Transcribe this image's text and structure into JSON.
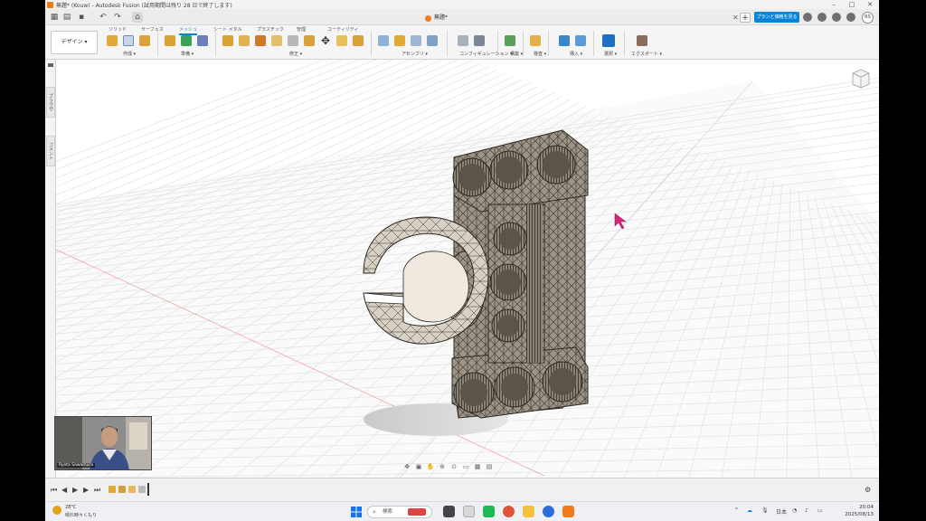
{
  "window": {
    "title": "無題* (Kouw) - Autodesk Fusion (試用期間は残り 28 日で終了します)",
    "min": "–",
    "max": "□",
    "close": "✕"
  },
  "qat": {
    "doc_tab": "無題*",
    "tab_close": "✕",
    "new_tab": "+",
    "upgrade_label": "プランと価格を見る",
    "user_initials": "RS"
  },
  "ribbon": {
    "workspace": "デザイン ▾",
    "tabs": [
      "ソリッド",
      "サーフェス",
      "メッシュ",
      "シート メタル",
      "プラスチック",
      "管理",
      "ユーティリティ"
    ],
    "active_tab": "メッシュ",
    "groups": [
      "作成 ▾",
      "準備 ▾",
      "修正 ▾",
      "アセンブリ ▾",
      "コンフィギュレーション ▾",
      "構築 ▾",
      "検査 ▾",
      "挿入 ▾",
      "選択 ▾",
      "エクスポート ▾"
    ]
  },
  "left_panel": {
    "tab1": "ブラウザ",
    "tab2": "コメント"
  },
  "webcam": {
    "name": "Ryota Sawamura"
  },
  "taskbar": {
    "weather_temp": "28°C",
    "weather_desc": "晴れ時々くもり",
    "search_placeholder": "検索",
    "ime": "日本",
    "time": "20:04",
    "date": "2025/08/13"
  },
  "colors": {
    "accent": "#0a84d6",
    "fusion_orange": "#f07b1d",
    "model": "#b8afa2"
  }
}
